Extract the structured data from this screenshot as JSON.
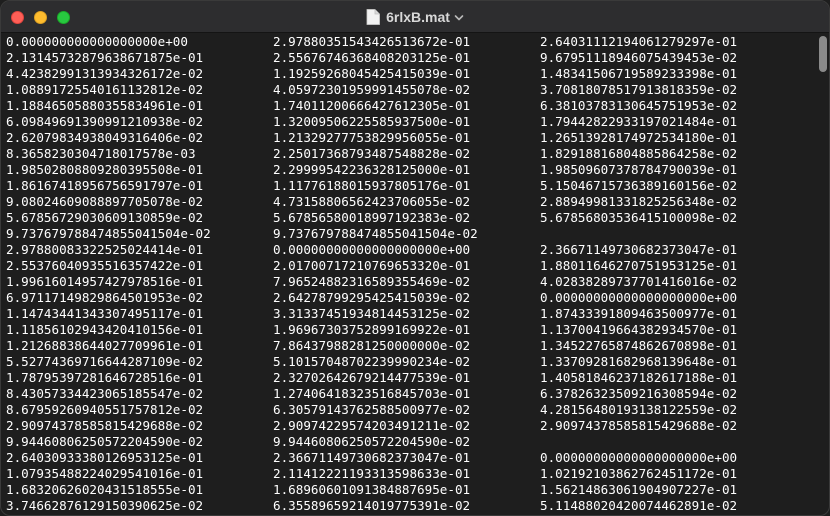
{
  "window": {
    "title": "6rlxB.mat"
  },
  "rows": [
    [
      "0.000000000000000000e+00",
      "2.978803515434265136 72e-01",
      "2.640311121940612792 97e-01"
    ],
    [
      "2.131457328796386718 75e-01",
      "2.556767463684082031 25e-01",
      "9.679511189460754394 53e-02"
    ],
    [
      "4.423829913139343261 72e-02",
      "1.192592680454254150 39e-01",
      "1.483415067195892333 98e-01"
    ],
    [
      "1.088917255401611328 12e-02",
      "4.059723019599914550 78e-02",
      "3.708180785179138183 59e-02"
    ],
    [
      "1.188465058803558349 61e-01",
      "1.740112006664276123 05e-01",
      "6.381037831306457519 53e-02"
    ],
    [
      "6.098496913909912109 38e-02",
      "1.320095062255859375 00e-01",
      "1.794428229331970214 84e-01"
    ],
    [
      "2.620798349380493164 06e-02",
      "1.213292777538299560 55e-01",
      "1.265139281749725341 80e-01"
    ],
    [
      "8.365823030471801757 8e-03",
      "2.250173687934875488 28e-02",
      "1.829188168048858642 58e-02"
    ],
    [
      "1.985028088092803955 08e-01",
      "2.299995422363281250 00e-01",
      "1.985096073787847900 39e-01"
    ],
    [
      "1.861674189567565917 97e-01",
      "1.117761880159378051 76e-01",
      "5.150467157363891601 56e-02"
    ],
    [
      "9.080246090888977050 78e-02",
      "4.731588065624237060 55e-02",
      "2.889499813318252563 48e-02"
    ],
    [
      "5.678567290306091308 59e-02",
      "5.678565800189971923 83e-02",
      "5.678568035364151000 98e-02"
    ],
    [
      "9.737679788474855041 504e-02",
      "9.737679788474855041 504e-02",
      ""
    ],
    [
      "2.978800833225250244 14e-01",
      "0.000000000000000000 00e+00",
      "2.366711497306823730 47e-01"
    ],
    [
      "2.553760409355163574 22e-01",
      "2.017007172107696533 20e-01",
      "1.880116462707519531 25e-01"
    ],
    [
      "1.996160149574279785 16e-01",
      "7.965248823165893554 69e-02",
      "4.028382897377014160 16e-02"
    ],
    [
      "6.971171498298645019 53e-02",
      "2.642787992954254150 39e-02",
      "0.000000000000000000 00e+00"
    ],
    [
      "1.147434413433074951 17e-01",
      "3.313374519348144531 25e-02",
      "1.874333918094635009 77e-01"
    ],
    [
      "1.118561029434204101 56e-01",
      "1.969673037528991699 22e-01",
      "1.137004196643829345 70e-01"
    ],
    [
      "1.212688386440277099 61e-01",
      "7.864379882812500000 00e-02",
      "1.345227658748626708 98e-01"
    ],
    [
      "5.527743697166442871 09e-02",
      "5.101570487022399902 34e-02",
      "1.337092816829681396 48e-01"
    ],
    [
      "1.787953972816467285 16e-01",
      "2.327026426792144775 39e-01",
      "1.405818462371826171 88e-01"
    ],
    [
      "8.430573344230651855 47e-02",
      "1.274064183235168457 03e-01",
      "6.378263235092163085 94e-02"
    ],
    [
      "8.679592609405517578 12e-02",
      "6.305791437625885009 77e-02",
      "4.281564801931381225 59e-02"
    ],
    [
      "2.909743785858154296 88e-02",
      "2.909742295742034912 11e-02",
      "2.909743785858154296 88e-02"
    ],
    [
      "9.944608062505722045 90e-02",
      "9.944608062505722045 90e-02",
      ""
    ],
    [
      "2.640309333801269531 25e-01",
      "2.366711497306823730 47e-01",
      "0.000000000000000000 00e+00"
    ],
    [
      "1.079354882240295410 16e-01",
      "2.114122211933135986 33e-01",
      "1.021921038627624511 72e-01"
    ],
    [
      "1.683206260204315185 55e-01",
      "1.689606010913848876 95e-01",
      "1.562148630619049072 27e-01"
    ],
    [
      "3.746628761291503906 25e-02",
      "6.355896592140197753 91e-02",
      "5.114880204200744628 91e-02"
    ]
  ]
}
